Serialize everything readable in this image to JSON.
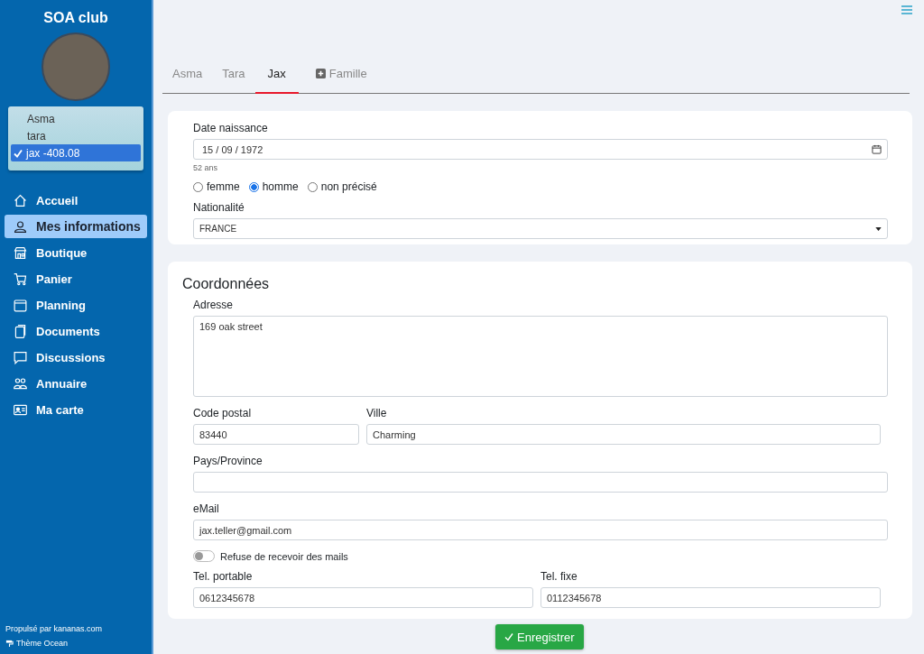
{
  "sidebar": {
    "title": "SOA club",
    "profiles": [
      {
        "label": "Asma",
        "selected": false
      },
      {
        "label": "tara",
        "selected": false
      },
      {
        "label": "jax -408.08",
        "selected": true
      }
    ],
    "nav": [
      {
        "label": "Accueil",
        "kind": "home",
        "selected": false
      },
      {
        "label": "Mes informations",
        "kind": "person",
        "selected": true
      },
      {
        "label": "Boutique",
        "kind": "shop",
        "selected": false
      },
      {
        "label": "Panier",
        "kind": "cart",
        "selected": false
      },
      {
        "label": "Planning",
        "kind": "calendar",
        "selected": false
      },
      {
        "label": "Documents",
        "kind": "documents",
        "selected": false
      },
      {
        "label": "Discussions",
        "kind": "chat",
        "selected": false
      },
      {
        "label": "Annuaire",
        "kind": "people",
        "selected": false
      },
      {
        "label": "Ma carte",
        "kind": "card",
        "selected": false
      }
    ],
    "powered": "Propulsé par kananas.com",
    "theme": "Thème Ocean"
  },
  "tabs": [
    {
      "label": "Asma",
      "kind": "member",
      "selected": false
    },
    {
      "label": "Tara",
      "kind": "member",
      "selected": false
    },
    {
      "label": "Jax",
      "kind": "member",
      "selected": true
    },
    {
      "label": "Famille",
      "kind": "add",
      "selected": false
    }
  ],
  "identity": {
    "birth_label": "Date naissance",
    "birth_value": "15 / 09 / 1972",
    "age": "52 ans",
    "genders": [
      {
        "label": "femme",
        "selected": false
      },
      {
        "label": "homme",
        "selected": true
      },
      {
        "label": "non précisé",
        "selected": false
      }
    ],
    "nationality_label": "Nationalité",
    "nationality_value": "FRANCE"
  },
  "contact": {
    "title": "Coordonnées",
    "address_label": "Adresse",
    "address_value": "169 oak street",
    "postal_label": "Code postal",
    "postal_value": "83440",
    "city_label": "Ville",
    "city_value": "Charming",
    "country_label": "Pays/Province",
    "email_label": "eMail",
    "email_value": "jax.teller@gmail.com",
    "refuse_mails": {
      "label": "Refuse de recevoir des mails",
      "on": false
    },
    "mobile_label": "Tel. portable",
    "mobile_value": "0612345678",
    "phone_label": "Tel. fixe",
    "phone_value": "0112345678"
  },
  "save_button": "Enregistrer"
}
